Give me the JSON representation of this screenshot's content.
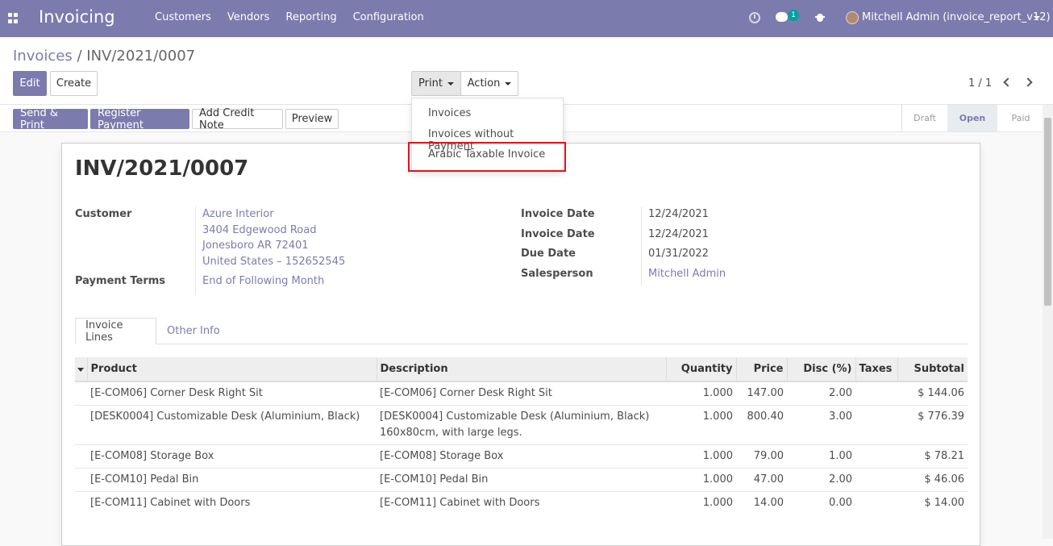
{
  "navbar": {
    "app_title": "Invoicing",
    "menu": [
      "Customers",
      "Vendors",
      "Reporting",
      "Configuration"
    ],
    "chat_badge": "1",
    "user": "Mitchell Admin (invoice_report_v12)"
  },
  "breadcrumb": {
    "parent": "Invoices",
    "separator": "/",
    "current": "INV/2021/0007"
  },
  "toolbar": {
    "edit": "Edit",
    "create": "Create",
    "print": "Print",
    "action": "Action",
    "pager": "1 / 1"
  },
  "print_menu": [
    "Invoices",
    "Invoices without Payment",
    "Arabic Taxable Invoice"
  ],
  "statusbar": {
    "buttons": [
      "Send & Print",
      "Register Payment",
      "Add Credit Note",
      "Preview"
    ],
    "stages": [
      "Draft",
      "Open",
      "Paid"
    ],
    "active_stage": "Open"
  },
  "invoice": {
    "number": "INV/2021/0007",
    "customer_label": "Customer",
    "customer_lines": [
      "Azure Interior",
      "3404 Edgewood Road",
      "Jonesboro AR 72401",
      "United States – 152652545"
    ],
    "payment_terms_label": "Payment Terms",
    "payment_terms": "End of Following Month",
    "invoice_date_label": "Invoice Date",
    "invoice_date": "12/24/2021",
    "invoice_date_label_2": "Invoice Date",
    "invoice_date_2": "12/24/2021",
    "due_date_label": "Due Date",
    "due_date": "01/31/2022",
    "salesperson_label": "Salesperson",
    "salesperson": "Mitchell Admin"
  },
  "tabs": [
    "Invoice Lines",
    "Other Info"
  ],
  "lines": {
    "headers": [
      "Product",
      "Description",
      "Quantity",
      "Price",
      "Disc (%)",
      "Taxes",
      "Subtotal"
    ],
    "rows": [
      {
        "product": "[E-COM06] Corner Desk Right Sit",
        "description": "[E-COM06] Corner Desk Right Sit",
        "quantity": "1.000",
        "price": "147.00",
        "disc": "2.00",
        "taxes": "",
        "subtotal": "$ 144.06"
      },
      {
        "product": "[DESK0004] Customizable Desk (Aluminium, Black)",
        "description": "[DESK0004] Customizable Desk (Aluminium, Black) 160x80cm, with large legs.",
        "quantity": "1.000",
        "price": "800.40",
        "disc": "3.00",
        "taxes": "",
        "subtotal": "$ 776.39"
      },
      {
        "product": "[E-COM08] Storage Box",
        "description": "[E-COM08] Storage Box",
        "quantity": "1.000",
        "price": "79.00",
        "disc": "1.00",
        "taxes": "",
        "subtotal": "$ 78.21"
      },
      {
        "product": "[E-COM10] Pedal Bin",
        "description": "[E-COM10] Pedal Bin",
        "quantity": "1.000",
        "price": "47.00",
        "disc": "2.00",
        "taxes": "",
        "subtotal": "$ 46.06"
      },
      {
        "product": "[E-COM11] Cabinet with Doors",
        "description": "[E-COM11] Cabinet with Doors",
        "quantity": "1.000",
        "price": "14.00",
        "disc": "0.00",
        "taxes": "",
        "subtotal": "$ 14.00"
      }
    ]
  },
  "colors": {
    "brand": "#7c7bad",
    "highlight": "#e0131c",
    "badge": "#00a09d"
  }
}
